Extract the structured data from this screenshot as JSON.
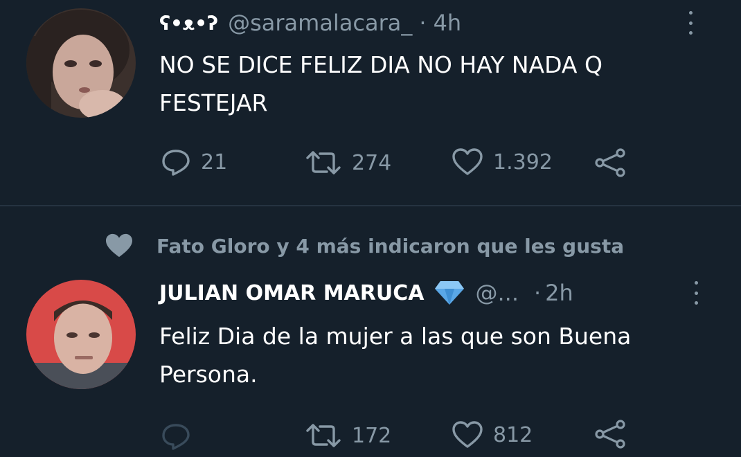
{
  "tweet1": {
    "display_name": "ʕ•ᴥ•ʔ",
    "handle": "@saramalacara_",
    "separator": "·",
    "time": "4h",
    "text_line1": "NO SE DICE FELIZ DIA NO HAY NADA Q",
    "text_line2": "FESTEJAR",
    "replies": "21",
    "retweets": "274",
    "likes": "1.392"
  },
  "social_context": {
    "text": "Fato Gloro y 4 más indicaron que les gusta"
  },
  "tweet2": {
    "display_name": "JULIAN OMAR MARUCA",
    "verified_badge_icon": "diamond-icon",
    "handle": "@...",
    "separator": "·",
    "time": "2h",
    "text_line1": "Feliz Dia de la mujer a las que son Buena",
    "text_line2": "Persona.",
    "retweets": "172",
    "likes": "812"
  },
  "colors": {
    "background": "#15202b",
    "muted": "#8899a6",
    "text": "#ffffff",
    "badge": "#5aa7e6"
  }
}
